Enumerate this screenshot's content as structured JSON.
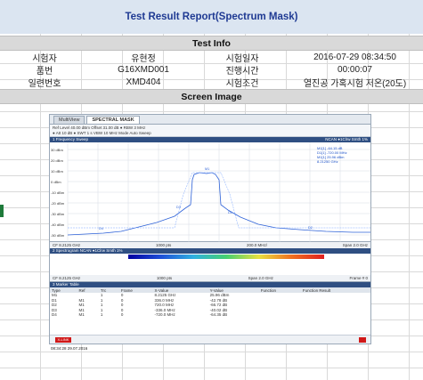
{
  "report": {
    "title": "Test Result Report(Spectrum Mask)",
    "info_header": "Test Info",
    "screen_header": "Screen Image",
    "rows": [
      {
        "label1": "시험자",
        "value1": "유현정",
        "label2": "시험일자",
        "value2": "2016-07-29 08:34:50"
      },
      {
        "label1": "품번",
        "value1": "G16XMD001",
        "label2": "진행시간",
        "value2": "00:00:07"
      },
      {
        "label1": "일련번호",
        "value1": "XMD404",
        "label2": "시험조건",
        "value2": "열진공 가혹시험 저온(20도)"
      }
    ]
  },
  "analyzer": {
    "tabs": [
      {
        "label": "MultiView"
      },
      {
        "label": "SPECTRAL MASK"
      }
    ],
    "settings_line1": "Ref Level 40.00 dBm   Offset 31.00 dB ● RBW 3 MHz",
    "settings_line2": "● Att 10 dB ● SWT 1 s VBW 10 MHz Mode Auto Sweep",
    "pane1_title": "1 Frequency Sweep",
    "pane1_right": "NCAN ●1Clrw Smth 1%",
    "y_ticks": [
      "30 dBm",
      "20 dBm",
      "10 dBm",
      "0 dBm",
      "-10 dBm",
      "-20 dBm",
      "-30 dBm",
      "-40 dBm",
      "-50 dBm"
    ],
    "marker_readout": [
      "M1[1]   -64.15 dB",
      "D1[1]   -720.00 MHz",
      "M1[1]   25.96 dBm",
      "     8.21250 GHz"
    ],
    "x_start": "CF 8.2125 GHz",
    "x_pts": "1000 pts",
    "x_mid": "200.0 MHz/",
    "x_span": "Span 2.0 GHz",
    "pane2_title": "2 Spectrogram  NCAN ●1Clrw Smth 1%",
    "pane2_left": "CF 8.2125 GHz",
    "pane2_pts": "1000 pts",
    "pane2_span": "Span 2.0 GHz",
    "pane2_frame": "Frame # 0",
    "marker_table_title": "3 Marker Table",
    "marker_cols": [
      "Type",
      "Ref",
      "Trc",
      "Frame",
      "X-Value",
      "Y-Value",
      "Function",
      "Function Result"
    ],
    "markers": [
      [
        "M1",
        "",
        "1",
        "0",
        "8.2125 GHz",
        "25.96 dBm",
        "",
        ""
      ],
      [
        "D1",
        "M1",
        "1",
        "0",
        "336.0 MHz",
        "-42.78 dB",
        "",
        ""
      ],
      [
        "D2",
        "M1",
        "1",
        "0",
        "720.0 MHz",
        "-66.72 dB",
        "",
        ""
      ],
      [
        "D3",
        "M1",
        "1",
        "0",
        "-336.0 MHz",
        "-40.02 dB",
        "",
        ""
      ],
      [
        "D4",
        "M1",
        "1",
        "0",
        "-720.0 MHz",
        "-64.35 dB",
        "",
        ""
      ]
    ],
    "status_led": "X-LINK",
    "timestamp": "08:34:28 29.07.2016"
  }
}
